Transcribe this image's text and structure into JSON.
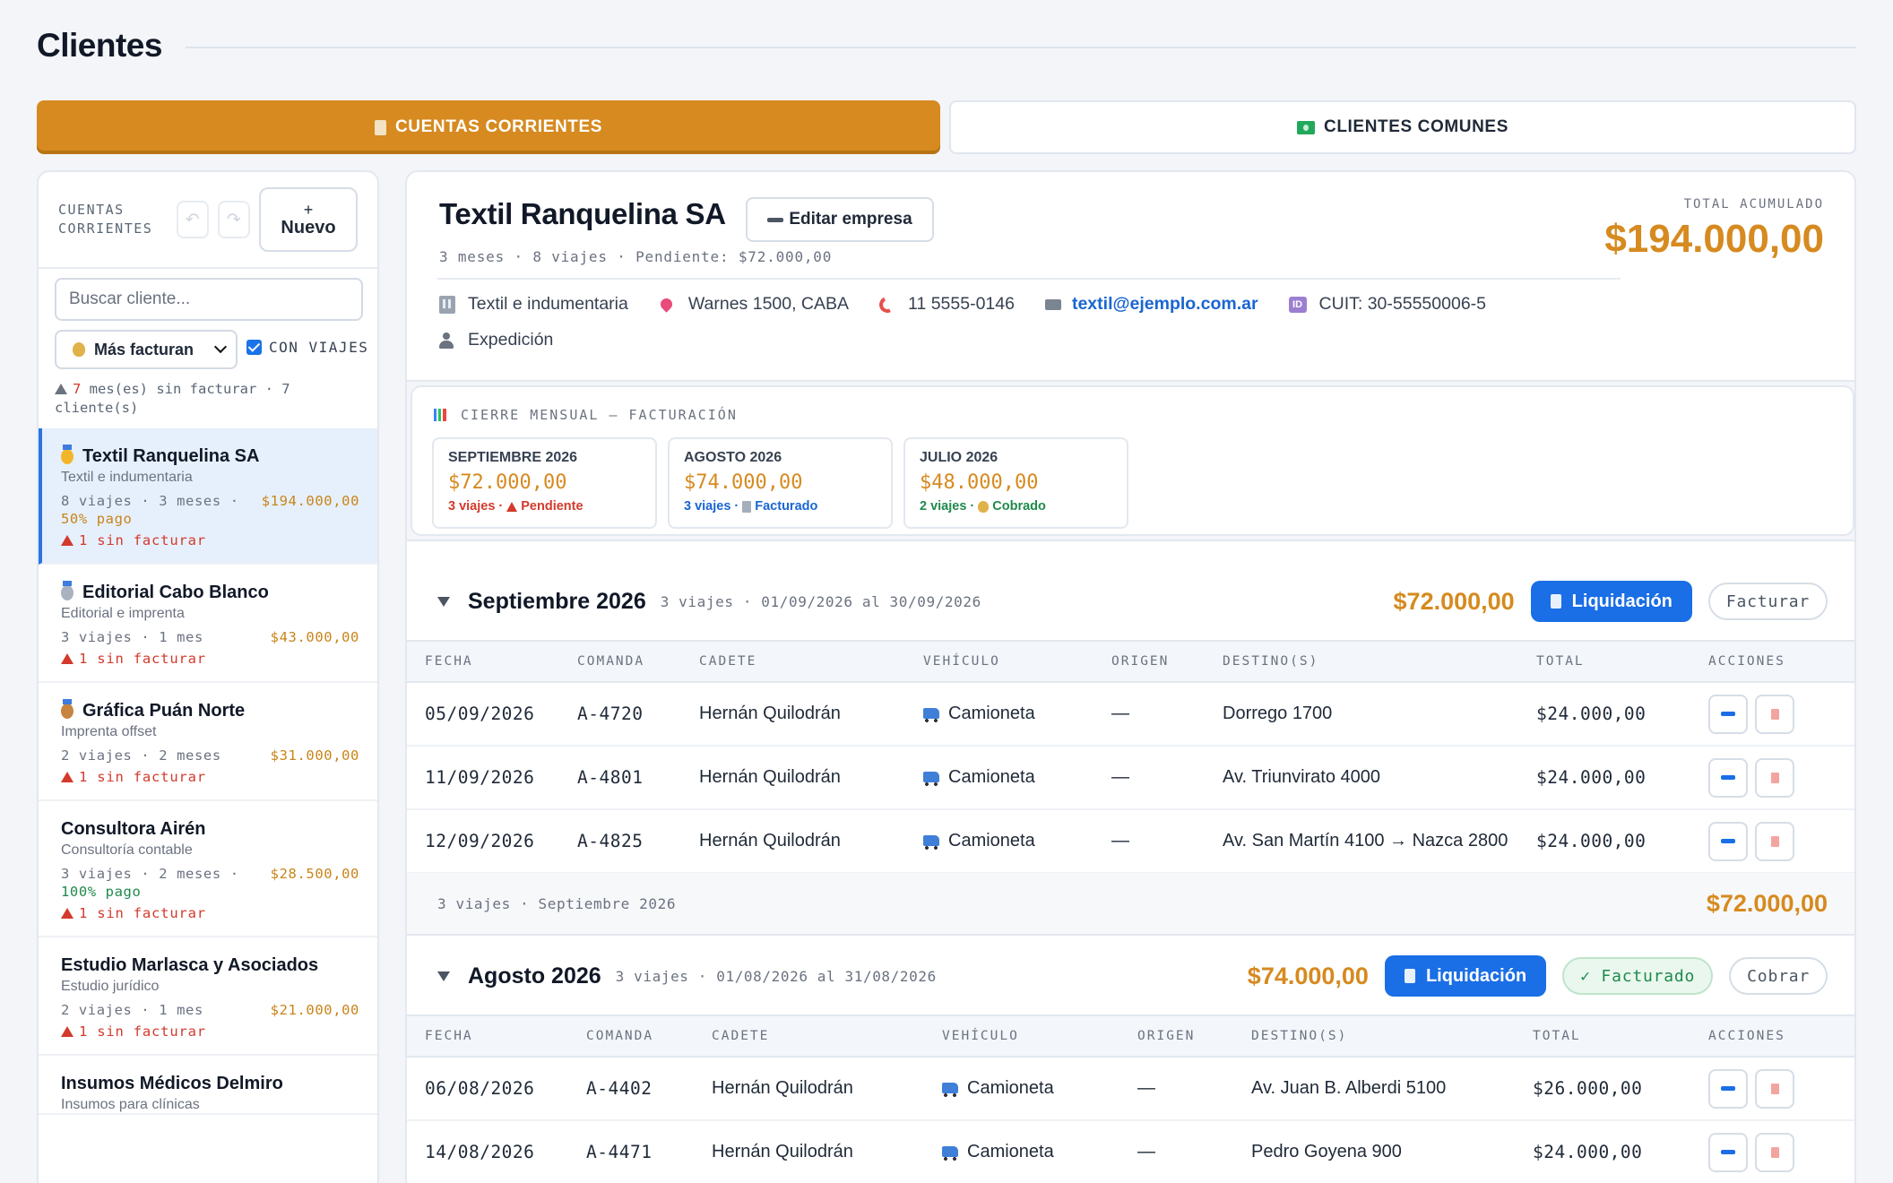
{
  "page": {
    "title": "Clientes"
  },
  "tabs": [
    {
      "label": "CUENTAS CORRIENTES",
      "icon": "ledger-icon",
      "active": true
    },
    {
      "label": "CLIENTES COMUNES",
      "icon": "money-icon",
      "active": false
    }
  ],
  "sidebar": {
    "title": "CUENTAS CORRIENTES",
    "new_plus": "+",
    "new_label": "Nuevo",
    "search_placeholder": "Buscar cliente...",
    "sort_label": "Más facturan",
    "checkbox_label": "CON VIAJES",
    "warning": {
      "months": "7",
      "text_a": " mes(es) sin facturar · 7 cliente(s)"
    },
    "clients": [
      {
        "name": "Textil Ranquelina SA",
        "medal": "gold",
        "sub": "Textil e indumentaria",
        "stats": "8 viajes · 3 meses ·",
        "amount": "$194.000,00",
        "pago": "50% pago",
        "warn": "1 sin facturar"
      },
      {
        "name": "Editorial Cabo Blanco",
        "medal": "silver",
        "sub": "Editorial e imprenta",
        "stats": "3 viajes · 1 mes",
        "amount": "$43.000,00",
        "pago": "",
        "warn": "1 sin facturar"
      },
      {
        "name": "Gráfica Puán Norte",
        "medal": "bronze",
        "sub": "Imprenta offset",
        "stats": "2 viajes · 2 meses",
        "amount": "$31.000,00",
        "pago": "",
        "warn": "1 sin facturar"
      },
      {
        "name": "Consultora Airén",
        "medal": "",
        "sub": "Consultoría contable",
        "stats": "3 viajes · 2 meses ·",
        "amount": "$28.500,00",
        "pago": "100% pago",
        "warn": "1 sin facturar"
      },
      {
        "name": "Estudio Marlasca y Asociados",
        "medal": "",
        "sub": "Estudio jurídico",
        "stats": "2 viajes · 1 mes",
        "amount": "$21.000,00",
        "pago": "",
        "warn": "1 sin facturar"
      },
      {
        "name": "Insumos Médicos Delmiro",
        "medal": "",
        "sub": "Insumos para clínicas",
        "stats": "",
        "amount": "",
        "pago": "",
        "warn": ""
      }
    ]
  },
  "company": {
    "name": "Textil Ranquelina SA",
    "edit_label": "Editar empresa",
    "meta": "3 meses · 8 viajes · Pendiente: $72.000,00",
    "total_label": "TOTAL ACUMULADO",
    "total_value": "$194.000,00",
    "industry": "Textil e indumentaria",
    "address": "Warnes 1500, CABA",
    "phone": "11 5555-0146",
    "email": "textil@ejemplo.com.ar",
    "cuit": "CUIT: 30-55550006-5",
    "contact": "Expedición"
  },
  "cierre": {
    "title": "CIERRE MENSUAL — FACTURACIÓN",
    "cards": [
      {
        "month": "SEPTIEMBRE 2026",
        "amount": "$72.000,00",
        "trips": "3 viajes ·",
        "status": "Pendiente",
        "tone": "red"
      },
      {
        "month": "AGOSTO 2026",
        "amount": "$74.000,00",
        "trips": "3 viajes ·",
        "status": "Facturado",
        "tone": "blue"
      },
      {
        "month": "JULIO 2026",
        "amount": "$48.000,00",
        "trips": "2 viajes ·",
        "status": "Cobrado",
        "tone": "green"
      }
    ]
  },
  "columns": [
    "FECHA",
    "COMANDA",
    "CADETE",
    "VEHÍCULO",
    "ORIGEN",
    "DESTINO(S)",
    "TOTAL",
    "ACCIONES"
  ],
  "sections": [
    {
      "title": "Septiembre 2026",
      "meta": "3 viajes · 01/09/2026 al 30/09/2026",
      "amount": "$72.000,00",
      "liq_label": "Liquidación",
      "action_label": "Facturar",
      "rows": [
        {
          "fecha": "05/09/2026",
          "comanda": "A-4720",
          "cadete": "Hernán Quilodrán",
          "vehiculo": "Camioneta",
          "origen": "—",
          "destino": "Dorrego 1700",
          "total": "$24.000,00"
        },
        {
          "fecha": "11/09/2026",
          "comanda": "A-4801",
          "cadete": "Hernán Quilodrán",
          "vehiculo": "Camioneta",
          "origen": "—",
          "destino": "Av. Triunvirato 4000",
          "total": "$24.000,00"
        },
        {
          "fecha": "12/09/2026",
          "comanda": "A-4825",
          "cadete": "Hernán Quilodrán",
          "vehiculo": "Camioneta",
          "origen": "—",
          "destino": "Av. San Martín 4100 → Nazca 2800",
          "total": "$24.000,00"
        }
      ],
      "footer_text": "3 viajes · Septiembre 2026",
      "footer_amount": "$72.000,00"
    },
    {
      "title": "Agosto 2026",
      "meta": "3 viajes · 01/08/2026 al 31/08/2026",
      "amount": "$74.000,00",
      "liq_label": "Liquidación",
      "badge_label": "✓ Facturado",
      "action_label": "Cobrar",
      "rows": [
        {
          "fecha": "06/08/2026",
          "comanda": "A-4402",
          "cadete": "Hernán Quilodrán",
          "vehiculo": "Camioneta",
          "origen": "—",
          "destino": "Av. Juan B. Alberdi 5100",
          "total": "$26.000,00"
        },
        {
          "fecha": "14/08/2026",
          "comanda": "A-4471",
          "cadete": "Hernán Quilodrán",
          "vehiculo": "Camioneta",
          "origen": "—",
          "destino": "Pedro Goyena 900",
          "total": "$24.000,00"
        }
      ]
    }
  ]
}
